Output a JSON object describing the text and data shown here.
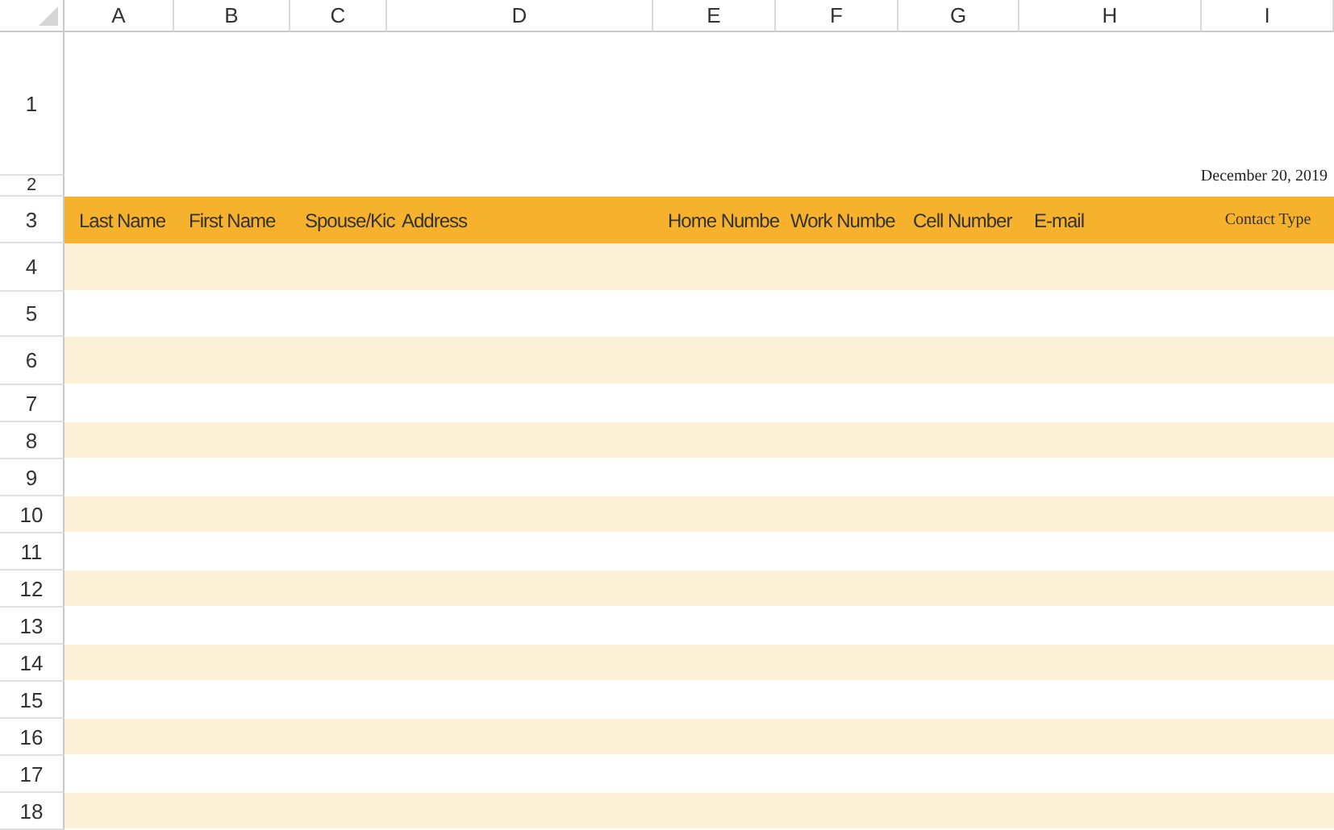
{
  "columns": [
    "A",
    "B",
    "C",
    "D",
    "E",
    "F",
    "G",
    "H",
    "I"
  ],
  "title_rows": [
    {
      "number": "1"
    },
    {
      "number": "2"
    }
  ],
  "date": "December 20, 2019",
  "header_row": {
    "number": "3",
    "cells": [
      {
        "text": "Last Name",
        "kind": "sans"
      },
      {
        "text": "First Name",
        "kind": "sans"
      },
      {
        "text": "Spouse/Kic",
        "kind": "sans"
      },
      {
        "text": "Address",
        "kind": "sans"
      },
      {
        "text": "Home Numbe",
        "kind": "sans"
      },
      {
        "text": "Work Numbe",
        "kind": "sans"
      },
      {
        "text": "Cell Number",
        "kind": "sans"
      },
      {
        "text": "E-mail",
        "kind": "sans"
      },
      {
        "text": "Contact Type",
        "kind": "serif"
      }
    ]
  },
  "rows": [
    {
      "number": "4",
      "shaded": true
    },
    {
      "number": "5",
      "shaded": false
    },
    {
      "number": "6",
      "shaded": true
    },
    {
      "number": "7",
      "shaded": false
    },
    {
      "number": "8",
      "shaded": true
    },
    {
      "number": "9",
      "shaded": false
    },
    {
      "number": "10",
      "shaded": true
    },
    {
      "number": "11",
      "shaded": false
    },
    {
      "number": "12",
      "shaded": true
    },
    {
      "number": "13",
      "shaded": false
    },
    {
      "number": "14",
      "shaded": true
    },
    {
      "number": "15",
      "shaded": false
    },
    {
      "number": "16",
      "shaded": true
    },
    {
      "number": "17",
      "shaded": false
    },
    {
      "number": "18",
      "shaded": true
    }
  ]
}
